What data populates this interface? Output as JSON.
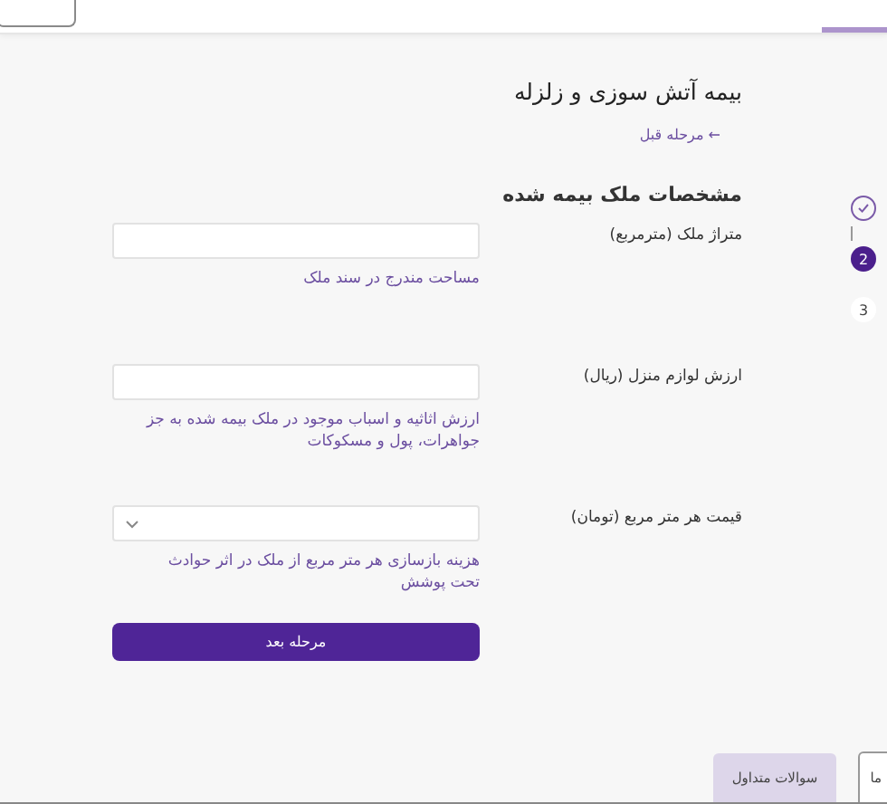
{
  "title": "بیمه آتش سوزی و زلزله",
  "back_link": "← مرحله قبل",
  "steps": [
    {
      "done": true,
      "current": false
    },
    {
      "label": "2",
      "done": false,
      "current": true
    },
    {
      "label": "3",
      "done": false,
      "current": false
    }
  ],
  "section_title": "مشخصات ملک بیمه شده",
  "fields": [
    {
      "kind": "text",
      "label": "متراژ ملک (مترمربع)",
      "hint": "مساحت مندرج در سند ملک"
    },
    {
      "kind": "text",
      "label": "ارزش لوازم منزل (ریال)",
      "hint": "ارزش اثاثیه و اسباب موجود در ملک بیمه شده به جز جواهرات، پول و مسکوکات"
    },
    {
      "kind": "select",
      "label": "قیمت هر متر مربع (تومان)",
      "hint": "هزینه بازسازی هر متر مربع از ملک در اثر حوادث تحت پوشش"
    }
  ],
  "next_button": "مرحله بعد",
  "bottom_tabs": [
    {
      "label": "ما",
      "selected": false
    },
    {
      "label": "سوالات متداول",
      "selected": true
    }
  ]
}
